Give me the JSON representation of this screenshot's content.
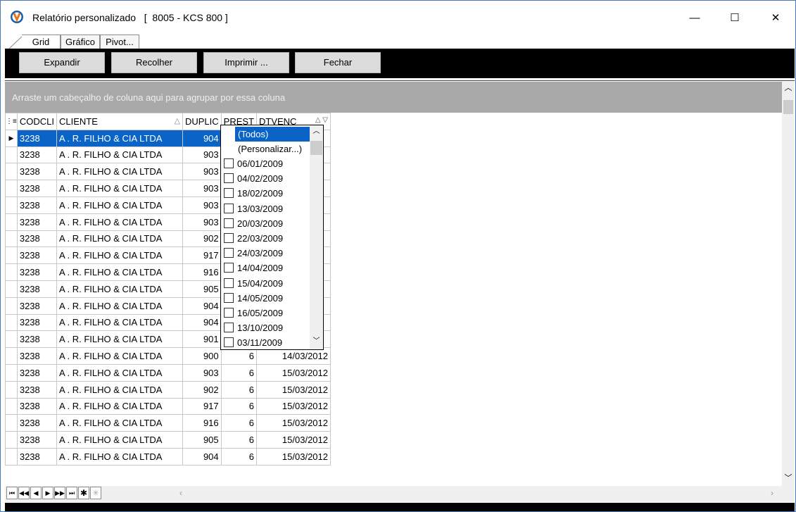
{
  "window": {
    "title": "Relatório personalizado   [  8005 - KCS 800 ]",
    "minimize": "—",
    "maximize": "☐",
    "close": "✕"
  },
  "tabs": [
    "Grid",
    "Gráfico",
    "Pivot..."
  ],
  "toolbar": {
    "expand": "Expandir",
    "collapse": "Recolher",
    "print": "Imprimir ...",
    "close": "Fechar"
  },
  "group_panel": "Arraste um cabeçalho de coluna aqui para agrupar por essa coluna",
  "columns": [
    "CODCLI",
    "CLIENTE",
    "DUPLIC",
    "PREST",
    "DTVENC"
  ],
  "rows": [
    [
      "3238",
      "A . R.  FILHO & CIA LTDA",
      "904",
      "",
      ""
    ],
    [
      "3238",
      "A . R.  FILHO & CIA LTDA",
      "903",
      "",
      ""
    ],
    [
      "3238",
      "A . R.  FILHO & CIA LTDA",
      "903",
      "",
      ""
    ],
    [
      "3238",
      "A . R.  FILHO & CIA LTDA",
      "903",
      "",
      ""
    ],
    [
      "3238",
      "A . R.  FILHO & CIA LTDA",
      "903",
      "",
      ""
    ],
    [
      "3238",
      "A . R.  FILHO & CIA LTDA",
      "903",
      "",
      ""
    ],
    [
      "3238",
      "A . R.  FILHO & CIA LTDA",
      "902",
      "",
      ""
    ],
    [
      "3238",
      "A . R.  FILHO & CIA LTDA",
      "917",
      "",
      ""
    ],
    [
      "3238",
      "A . R.  FILHO & CIA LTDA",
      "916",
      "",
      ""
    ],
    [
      "3238",
      "A . R.  FILHO & CIA LTDA",
      "905",
      "",
      ""
    ],
    [
      "3238",
      "A . R.  FILHO & CIA LTDA",
      "904",
      "",
      ""
    ],
    [
      "3238",
      "A . R.  FILHO & CIA LTDA",
      "904",
      "",
      ""
    ],
    [
      "3238",
      "A . R.  FILHO & CIA LTDA",
      "901",
      "",
      ""
    ],
    [
      "3238",
      "A . R.  FILHO & CIA LTDA",
      "900",
      "6",
      "14/03/2012"
    ],
    [
      "3238",
      "A . R.  FILHO & CIA LTDA",
      "903",
      "6",
      "15/03/2012"
    ],
    [
      "3238",
      "A . R.  FILHO & CIA LTDA",
      "902",
      "6",
      "15/03/2012"
    ],
    [
      "3238",
      "A . R.  FILHO & CIA LTDA",
      "917",
      "6",
      "15/03/2012"
    ],
    [
      "3238",
      "A . R.  FILHO & CIA LTDA",
      "916",
      "6",
      "15/03/2012"
    ],
    [
      "3238",
      "A . R.  FILHO & CIA LTDA",
      "905",
      "6",
      "15/03/2012"
    ],
    [
      "3238",
      "A . R.  FILHO & CIA LTDA",
      "904",
      "6",
      "15/03/2012"
    ]
  ],
  "filter_dropdown": {
    "items": [
      "(Todos)",
      "(Personalizar...)"
    ],
    "dates": [
      "06/01/2009",
      "04/02/2009",
      "18/02/2009",
      "13/03/2009",
      "20/03/2009",
      "22/03/2009",
      "24/03/2009",
      "14/04/2009",
      "15/04/2009",
      "14/05/2009",
      "16/05/2009",
      "13/10/2009",
      "03/11/2009"
    ]
  },
  "colors": {
    "selection": "#0a64c8",
    "group_panel": "#a9a9a9",
    "toolbar": "#000000"
  }
}
